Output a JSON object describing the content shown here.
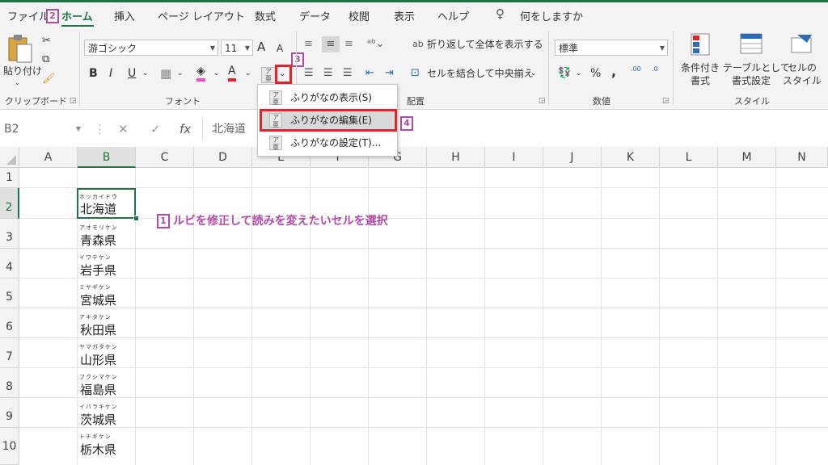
{
  "tabs": [
    {
      "label": "ファイル"
    },
    {
      "label": "ホーム"
    },
    {
      "label": "挿入"
    },
    {
      "label": "ページ レイアウト"
    },
    {
      "label": "数式"
    },
    {
      "label": "データ"
    },
    {
      "label": "校閲"
    },
    {
      "label": "表示"
    },
    {
      "label": "ヘルプ"
    },
    {
      "label": "何をしますか"
    }
  ],
  "markers": {
    "m1": "1",
    "m2": "2",
    "m3": "3",
    "m4": "4"
  },
  "ribbon": {
    "clipboard": {
      "paste": "貼り付け",
      "label": "クリップボード"
    },
    "font": {
      "name": "游ゴシック",
      "size": "11",
      "label": "フォント",
      "grow": "A",
      "shrink": "A",
      "bold": "B",
      "italic": "I",
      "underline": "U",
      "font_color": "A"
    },
    "alignment": {
      "wrap": "折り返して全体を表示する",
      "merge": "セルを結合して中央揃え",
      "label": "配置"
    },
    "number": {
      "format": "標準",
      "label": "数値",
      "percent": "%",
      "comma": ",",
      "inc": ".00",
      "dec": ".0"
    },
    "styles": {
      "cond1": "条件付き",
      "cond2": "書式",
      "table1": "テーブルとして",
      "table2": "書式設定",
      "cell1": "セルの",
      "cell2": "スタイル",
      "label": "スタイル"
    }
  },
  "formula_bar": {
    "name_box": "B2",
    "cancel": "✕",
    "enter": "✓",
    "fx": "fx",
    "content": "北海道"
  },
  "columns": [
    "A",
    "B",
    "C",
    "D",
    "E",
    "F",
    "G",
    "H",
    "I",
    "J",
    "K",
    "L",
    "M",
    "N"
  ],
  "rows": [
    "1",
    "2",
    "3",
    "4",
    "5",
    "6",
    "7",
    "8",
    "9",
    "10"
  ],
  "cells": [
    {
      "ruby": "ホッカイドウ",
      "text": "北海道"
    },
    {
      "ruby": "アオモリケン",
      "text": "青森県"
    },
    {
      "ruby": "イワテケン",
      "text": "岩手県"
    },
    {
      "ruby": "ミヤギケン",
      "text": "宮城県"
    },
    {
      "ruby": "アキタケン",
      "text": "秋田県"
    },
    {
      "ruby": "ヤマガタケン",
      "text": "山形県"
    },
    {
      "ruby": "フクシマケン",
      "text": "福島県"
    },
    {
      "ruby": "イバラキケン",
      "text": "茨城県"
    },
    {
      "ruby": "トチギケン",
      "text": "栃木県"
    }
  ],
  "annotation": "ルビを修正して読みを変えたいセルを選択",
  "menu": {
    "items": [
      {
        "label": "ふりがなの表示(S)"
      },
      {
        "label": "ふりがなの編集(E)"
      },
      {
        "label": "ふりがなの設定(T)..."
      }
    ]
  },
  "colors": {
    "accent": "#217346",
    "marker": "#b24aa8",
    "highlight": "#e8202a"
  }
}
